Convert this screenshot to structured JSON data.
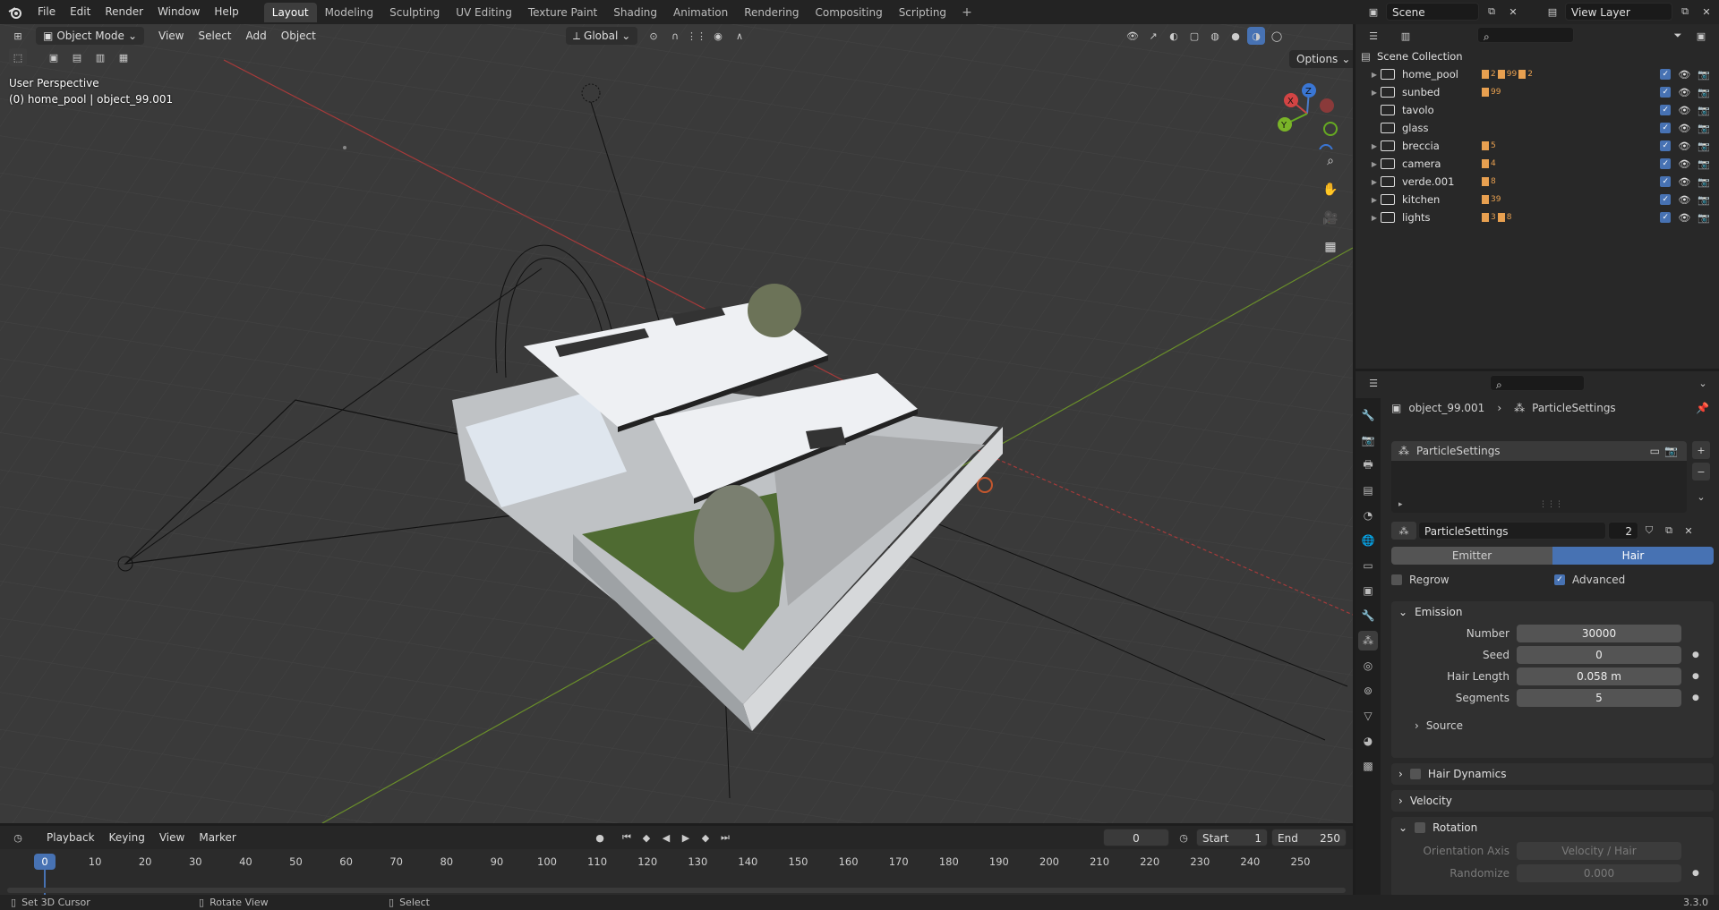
{
  "topbar": {
    "menus": [
      "File",
      "Edit",
      "Render",
      "Window",
      "Help"
    ],
    "workspaces": [
      "Layout",
      "Modeling",
      "Sculpting",
      "UV Editing",
      "Texture Paint",
      "Shading",
      "Animation",
      "Rendering",
      "Compositing",
      "Scripting"
    ],
    "active_workspace": "Layout",
    "add_tab": "+",
    "scene": "Scene",
    "view_layer": "View Layer"
  },
  "viewport": {
    "mode": "Object Mode",
    "menus": [
      "View",
      "Select",
      "Add",
      "Object"
    ],
    "transform_orientation": "Global",
    "options": "Options",
    "overlay_line1": "User Perspective",
    "overlay_line2": "(0) home_pool | object_99.001",
    "axis_x": "X",
    "axis_y": "Y",
    "axis_z": "Z"
  },
  "outliner": {
    "root": "Scene Collection",
    "items": [
      {
        "name": "home_pool",
        "badges": [
          "2",
          "99",
          "2"
        ]
      },
      {
        "name": "sunbed",
        "badges": [
          "99"
        ]
      },
      {
        "name": "tavolo",
        "badges": []
      },
      {
        "name": "glass",
        "badges": []
      },
      {
        "name": "breccia",
        "badges": [
          "5"
        ]
      },
      {
        "name": "camera",
        "badges": [
          "4"
        ]
      },
      {
        "name": "verde.001",
        "badges": [
          "8"
        ]
      },
      {
        "name": "kitchen",
        "badges": [
          "39"
        ]
      },
      {
        "name": "lights",
        "badges": [
          "3",
          "8"
        ]
      }
    ]
  },
  "properties": {
    "object": "object_99.001",
    "data": "ParticleSettings",
    "list_item": "ParticleSettings",
    "settings_name": "ParticleSettings",
    "users": "2",
    "type_emitter": "Emitter",
    "type_hair": "Hair",
    "regrow": "Regrow",
    "advanced": "Advanced",
    "emission": "Emission",
    "number_label": "Number",
    "number": "30000",
    "seed_label": "Seed",
    "seed": "0",
    "hair_length_label": "Hair Length",
    "hair_length": "0.058 m",
    "segments_label": "Segments",
    "segments": "5",
    "source": "Source",
    "hair_dynamics": "Hair Dynamics",
    "velocity": "Velocity",
    "rotation": "Rotation",
    "orientation_axis_label": "Orientation Axis",
    "orientation_axis": "Velocity / Hair",
    "randomize_label": "Randomize",
    "randomize": "0.000"
  },
  "timeline": {
    "menus": [
      "Playback",
      "Keying",
      "View",
      "Marker"
    ],
    "current_frame": "0",
    "start_label": "Start",
    "start": "1",
    "end_label": "End",
    "end": "250",
    "playhead": "0",
    "ticks": [
      "10",
      "20",
      "30",
      "40",
      "50",
      "60",
      "70",
      "80",
      "90",
      "100",
      "110",
      "120",
      "130",
      "140",
      "150",
      "160",
      "170",
      "180",
      "190",
      "200",
      "210",
      "220",
      "230",
      "240",
      "250"
    ]
  },
  "statusbar": {
    "left": "Set 3D Cursor",
    "middle": "Rotate View",
    "right": "Select",
    "version": "3.3.0"
  }
}
